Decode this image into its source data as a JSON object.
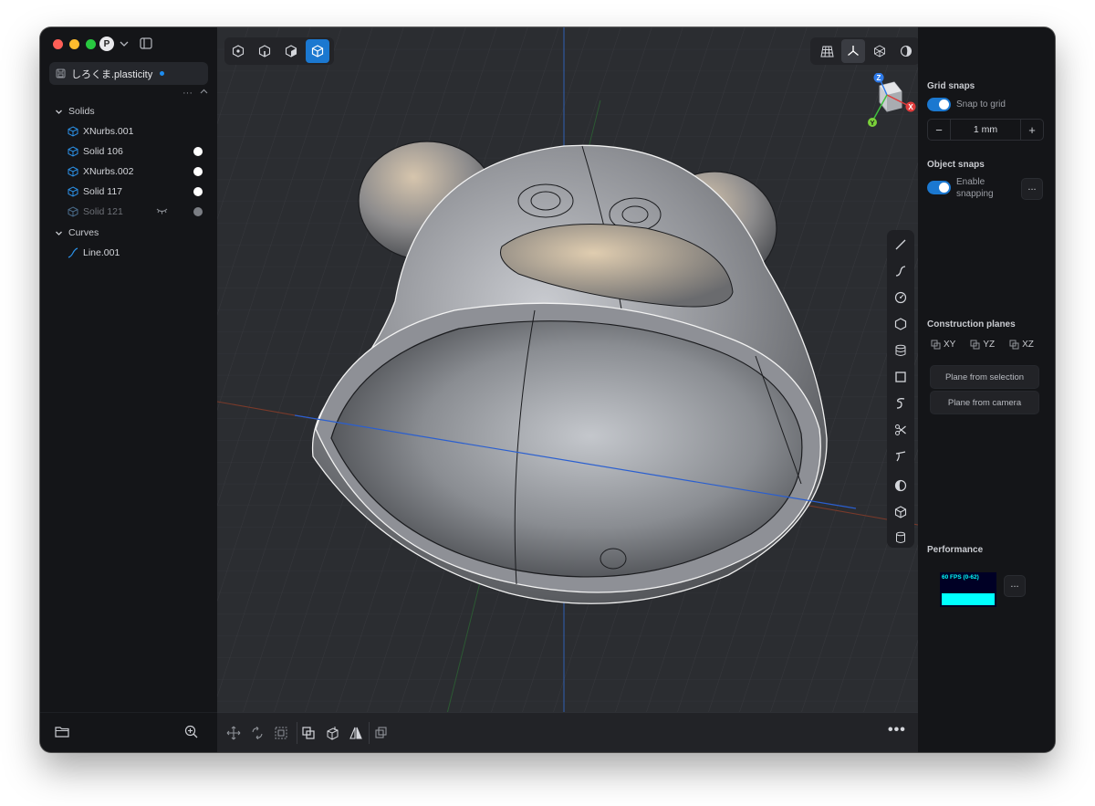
{
  "window": {
    "profile_initial": "P"
  },
  "file_tab": {
    "name": "しろくま.plasticity",
    "modified": true
  },
  "tree_tools": {
    "more": "···",
    "collapse": "^"
  },
  "outliner": {
    "solids_label": "Solids",
    "solids": [
      {
        "label": "XNurbs.001",
        "visible_dot": false,
        "hidden": false
      },
      {
        "label": "Solid 106",
        "visible_dot": true,
        "hidden": false
      },
      {
        "label": "XNurbs.002",
        "visible_dot": true,
        "hidden": false
      },
      {
        "label": "Solid 117",
        "visible_dot": true,
        "hidden": false
      },
      {
        "label": "Solid 121",
        "visible_dot": true,
        "hidden": true
      }
    ],
    "curves_label": "Curves",
    "curves": [
      {
        "label": "Line.001"
      }
    ]
  },
  "viewport": {
    "select_modes": [
      "vertex-mode-icon",
      "edge-mode-icon",
      "face-mode-icon",
      "solid-mode-icon"
    ],
    "active_mode": "solid-mode-icon",
    "view_tools": [
      "grid-icon",
      "axes-icon",
      "wireframe-icon",
      "shading-icon"
    ],
    "active_view_tool": "axes-icon",
    "gizmo": {
      "z": "Z",
      "x": "X",
      "y": "Y"
    },
    "axis_colors": {
      "x": "#e03c3c",
      "y": "#3fbf3f",
      "z": "#2f7bea"
    },
    "bottom_more": "•••"
  },
  "right_panel": {
    "grid_snaps_title": "Grid snaps",
    "snap_to_grid_label": "Snap to grid",
    "snap_to_grid_on": true,
    "grid_size": "1 mm",
    "minus": "−",
    "plus": "+",
    "object_snaps_title": "Object snaps",
    "enable_snapping_label_1": "Enable",
    "enable_snapping_label_2": "snapping",
    "enable_snapping_on": true,
    "more": "...",
    "construction_planes_title": "Construction planes",
    "planes": [
      "XY",
      "YZ",
      "XZ"
    ],
    "plane_from_selection": "Plane from selection",
    "plane_from_camera": "Plane from camera",
    "performance_title": "Performance",
    "fps_text": "60 FPS (0-62)",
    "accent": "#1b78d0"
  }
}
